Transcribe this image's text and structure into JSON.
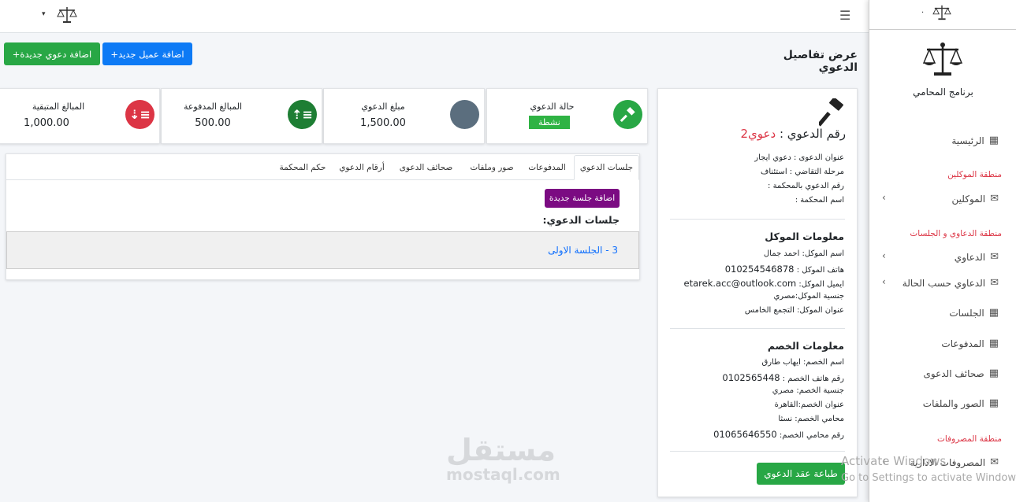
{
  "topbar": {
    "caret": "▾",
    "menu_icon": "☰"
  },
  "sidebar": {
    "top_dot": ".",
    "app_name": "برنامج المحامي",
    "home": "الرئيسية",
    "section_clients": "منطقة الموكلين",
    "clients": "الموكلين",
    "section_cases": "منطقة الدعاوي و الجلسات",
    "cases": "الدعاوي",
    "cases_by_status": "الدعاوي حسب الحالة",
    "sessions": "الجلسات",
    "payments": "المدفوعات",
    "case_sheets": "صحائف الدعوى",
    "images_files": "الصور والملفات",
    "section_expenses": "منطقة المصروفات",
    "admin_expenses": "المصروفات الادارية"
  },
  "header": {
    "page_title": "عرض تفاصيل الدعوي",
    "add_client": "+اضافة عميل جديد",
    "add_case": "+اضافة دعوي جديدة"
  },
  "stats": {
    "status_label": "حالة الدعوي",
    "status_value": "نشطة",
    "amount_label": "مبلغ الدعوي",
    "amount_value": "1,500.00",
    "paid_label": "المبالغ المدفوعة",
    "paid_value": "500.00",
    "remaining_label": "المبالغ المتبقية",
    "remaining_value": "1,000.00"
  },
  "case": {
    "number_label": "رقم الدعوي :",
    "number_value": "دعوي2",
    "title": "عنوان الدعوى : دعوي ايجار",
    "stage": "مرحلة التقاضي : استئناف",
    "court_number": "رقم الدعوي بالمحكمة :",
    "court_name": "اسم المحكمة :"
  },
  "client": {
    "heading": "معلومات الموكل",
    "name": "اسم الموكل: احمد جمال",
    "phone_label": "هاتف الموكل :",
    "phone": "010254546878",
    "email_label": "ايميل الموكل:",
    "email": "etarek.acc@outlook.com",
    "nationality": "جنسية الموكل:مصري",
    "address": "عنوان الموكل: التجمع الخامس"
  },
  "opponent": {
    "heading": "معلومات الخصم",
    "name": "اسم الخصم: ايهاب طارق",
    "phone_label": "رقم هاتف الخصم :",
    "phone": "0102565448",
    "nationality": "جنسية الخصم: مصري",
    "address": "عنوان الخصم:القاهرة",
    "lawyer": "محامي الخصم: نسثا",
    "lawyer_phone_label": "رقم محامي الخصم:",
    "lawyer_phone": "01065646550"
  },
  "print_button": "طباعة عقد الدعوي",
  "tabs": [
    "جلسات الدعوي",
    "المدفوعات",
    "صور وملفات",
    "صحائف الدعوى",
    "أرقام الدعوي",
    "حكم المحكمة"
  ],
  "sessions_panel": {
    "add_button": "اضافة جلسة جديدة",
    "heading": "جلسات الدعوي:",
    "item": "3 - الجلسة الاولى"
  },
  "watermark": {
    "arabic": "مستقل",
    "latin": "mostaql.com"
  },
  "activate": {
    "line1": "Activate Windows",
    "line2": "Go to Settings to activate Windows."
  },
  "colors": {
    "green": "#28a745",
    "blue": "#0d7af5",
    "purple": "#7b0b82",
    "red": "#dc3545",
    "gray_circle": "#5b6e7e",
    "badge": "#2fb344"
  },
  "icons": [
    "scale-icon",
    "hammer-icon",
    "arrow-down-sort-icon",
    "arrow-up-sort-icon",
    "table-icon",
    "envelope-icon",
    "chevron-left-icon",
    "menu-icon"
  ]
}
